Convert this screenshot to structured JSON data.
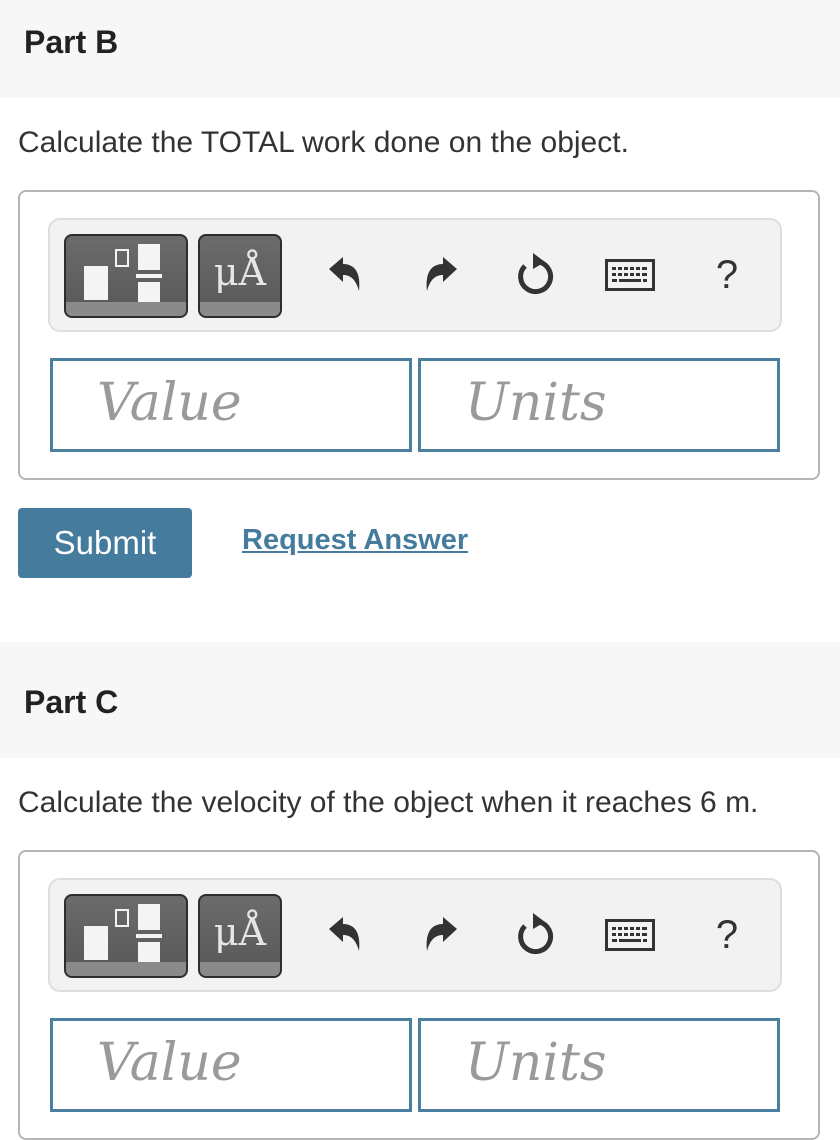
{
  "part_b": {
    "title": "Part B",
    "prompt": "Calculate the TOTAL work done on the object.",
    "units_button": "μÅ",
    "help": "?",
    "value_placeholder": "Value",
    "units_placeholder": "Units",
    "submit_label": "Submit",
    "request_answer_label": "Request Answer"
  },
  "part_c": {
    "title": "Part C",
    "prompt": "Calculate the velocity of the object when it reaches 6 m.",
    "units_button": "μÅ",
    "help": "?",
    "value_placeholder": "Value",
    "units_placeholder": "Units"
  },
  "colors": {
    "accent": "#457b9d",
    "input_border": "#4a7fa0",
    "header_bg": "#f7f7f7"
  },
  "icons": [
    "templates-icon",
    "units-icon",
    "undo-icon",
    "redo-icon",
    "reset-icon",
    "keyboard-icon",
    "help-icon"
  ]
}
